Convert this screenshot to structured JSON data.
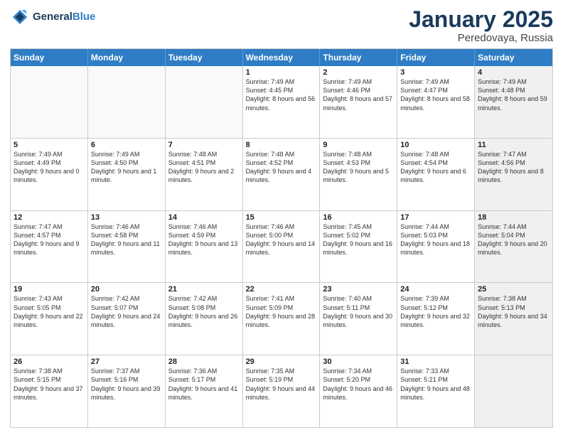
{
  "header": {
    "logo_general": "General",
    "logo_blue": "Blue",
    "title": "January 2025",
    "subtitle": "Peredovaya, Russia"
  },
  "days_of_week": [
    "Sunday",
    "Monday",
    "Tuesday",
    "Wednesday",
    "Thursday",
    "Friday",
    "Saturday"
  ],
  "weeks": [
    [
      {
        "day": "",
        "text": "",
        "shaded": false,
        "empty": true
      },
      {
        "day": "",
        "text": "",
        "shaded": false,
        "empty": true
      },
      {
        "day": "",
        "text": "",
        "shaded": false,
        "empty": true
      },
      {
        "day": "1",
        "text": "Sunrise: 7:49 AM\nSunset: 4:45 PM\nDaylight: 8 hours and 56 minutes.",
        "shaded": false,
        "empty": false
      },
      {
        "day": "2",
        "text": "Sunrise: 7:49 AM\nSunset: 4:46 PM\nDaylight: 8 hours and 57 minutes.",
        "shaded": false,
        "empty": false
      },
      {
        "day": "3",
        "text": "Sunrise: 7:49 AM\nSunset: 4:47 PM\nDaylight: 8 hours and 58 minutes.",
        "shaded": false,
        "empty": false
      },
      {
        "day": "4",
        "text": "Sunrise: 7:49 AM\nSunset: 4:48 PM\nDaylight: 8 hours and 59 minutes.",
        "shaded": true,
        "empty": false
      }
    ],
    [
      {
        "day": "5",
        "text": "Sunrise: 7:49 AM\nSunset: 4:49 PM\nDaylight: 9 hours and 0 minutes.",
        "shaded": false,
        "empty": false
      },
      {
        "day": "6",
        "text": "Sunrise: 7:49 AM\nSunset: 4:50 PM\nDaylight: 9 hours and 1 minute.",
        "shaded": false,
        "empty": false
      },
      {
        "day": "7",
        "text": "Sunrise: 7:48 AM\nSunset: 4:51 PM\nDaylight: 9 hours and 2 minutes.",
        "shaded": false,
        "empty": false
      },
      {
        "day": "8",
        "text": "Sunrise: 7:48 AM\nSunset: 4:52 PM\nDaylight: 9 hours and 4 minutes.",
        "shaded": false,
        "empty": false
      },
      {
        "day": "9",
        "text": "Sunrise: 7:48 AM\nSunset: 4:53 PM\nDaylight: 9 hours and 5 minutes.",
        "shaded": false,
        "empty": false
      },
      {
        "day": "10",
        "text": "Sunrise: 7:48 AM\nSunset: 4:54 PM\nDaylight: 9 hours and 6 minutes.",
        "shaded": false,
        "empty": false
      },
      {
        "day": "11",
        "text": "Sunrise: 7:47 AM\nSunset: 4:56 PM\nDaylight: 9 hours and 8 minutes.",
        "shaded": true,
        "empty": false
      }
    ],
    [
      {
        "day": "12",
        "text": "Sunrise: 7:47 AM\nSunset: 4:57 PM\nDaylight: 9 hours and 9 minutes.",
        "shaded": false,
        "empty": false
      },
      {
        "day": "13",
        "text": "Sunrise: 7:46 AM\nSunset: 4:58 PM\nDaylight: 9 hours and 11 minutes.",
        "shaded": false,
        "empty": false
      },
      {
        "day": "14",
        "text": "Sunrise: 7:46 AM\nSunset: 4:59 PM\nDaylight: 9 hours and 13 minutes.",
        "shaded": false,
        "empty": false
      },
      {
        "day": "15",
        "text": "Sunrise: 7:46 AM\nSunset: 5:00 PM\nDaylight: 9 hours and 14 minutes.",
        "shaded": false,
        "empty": false
      },
      {
        "day": "16",
        "text": "Sunrise: 7:45 AM\nSunset: 5:02 PM\nDaylight: 9 hours and 16 minutes.",
        "shaded": false,
        "empty": false
      },
      {
        "day": "17",
        "text": "Sunrise: 7:44 AM\nSunset: 5:03 PM\nDaylight: 9 hours and 18 minutes.",
        "shaded": false,
        "empty": false
      },
      {
        "day": "18",
        "text": "Sunrise: 7:44 AM\nSunset: 5:04 PM\nDaylight: 9 hours and 20 minutes.",
        "shaded": true,
        "empty": false
      }
    ],
    [
      {
        "day": "19",
        "text": "Sunrise: 7:43 AM\nSunset: 5:05 PM\nDaylight: 9 hours and 22 minutes.",
        "shaded": false,
        "empty": false
      },
      {
        "day": "20",
        "text": "Sunrise: 7:42 AM\nSunset: 5:07 PM\nDaylight: 9 hours and 24 minutes.",
        "shaded": false,
        "empty": false
      },
      {
        "day": "21",
        "text": "Sunrise: 7:42 AM\nSunset: 5:08 PM\nDaylight: 9 hours and 26 minutes.",
        "shaded": false,
        "empty": false
      },
      {
        "day": "22",
        "text": "Sunrise: 7:41 AM\nSunset: 5:09 PM\nDaylight: 9 hours and 28 minutes.",
        "shaded": false,
        "empty": false
      },
      {
        "day": "23",
        "text": "Sunrise: 7:40 AM\nSunset: 5:11 PM\nDaylight: 9 hours and 30 minutes.",
        "shaded": false,
        "empty": false
      },
      {
        "day": "24",
        "text": "Sunrise: 7:39 AM\nSunset: 5:12 PM\nDaylight: 9 hours and 32 minutes.",
        "shaded": false,
        "empty": false
      },
      {
        "day": "25",
        "text": "Sunrise: 7:38 AM\nSunset: 5:13 PM\nDaylight: 9 hours and 34 minutes.",
        "shaded": true,
        "empty": false
      }
    ],
    [
      {
        "day": "26",
        "text": "Sunrise: 7:38 AM\nSunset: 5:15 PM\nDaylight: 9 hours and 37 minutes.",
        "shaded": false,
        "empty": false
      },
      {
        "day": "27",
        "text": "Sunrise: 7:37 AM\nSunset: 5:16 PM\nDaylight: 9 hours and 39 minutes.",
        "shaded": false,
        "empty": false
      },
      {
        "day": "28",
        "text": "Sunrise: 7:36 AM\nSunset: 5:17 PM\nDaylight: 9 hours and 41 minutes.",
        "shaded": false,
        "empty": false
      },
      {
        "day": "29",
        "text": "Sunrise: 7:35 AM\nSunset: 5:19 PM\nDaylight: 9 hours and 44 minutes.",
        "shaded": false,
        "empty": false
      },
      {
        "day": "30",
        "text": "Sunrise: 7:34 AM\nSunset: 5:20 PM\nDaylight: 9 hours and 46 minutes.",
        "shaded": false,
        "empty": false
      },
      {
        "day": "31",
        "text": "Sunrise: 7:33 AM\nSunset: 5:21 PM\nDaylight: 9 hours and 48 minutes.",
        "shaded": false,
        "empty": false
      },
      {
        "day": "",
        "text": "",
        "shaded": true,
        "empty": true
      }
    ]
  ]
}
